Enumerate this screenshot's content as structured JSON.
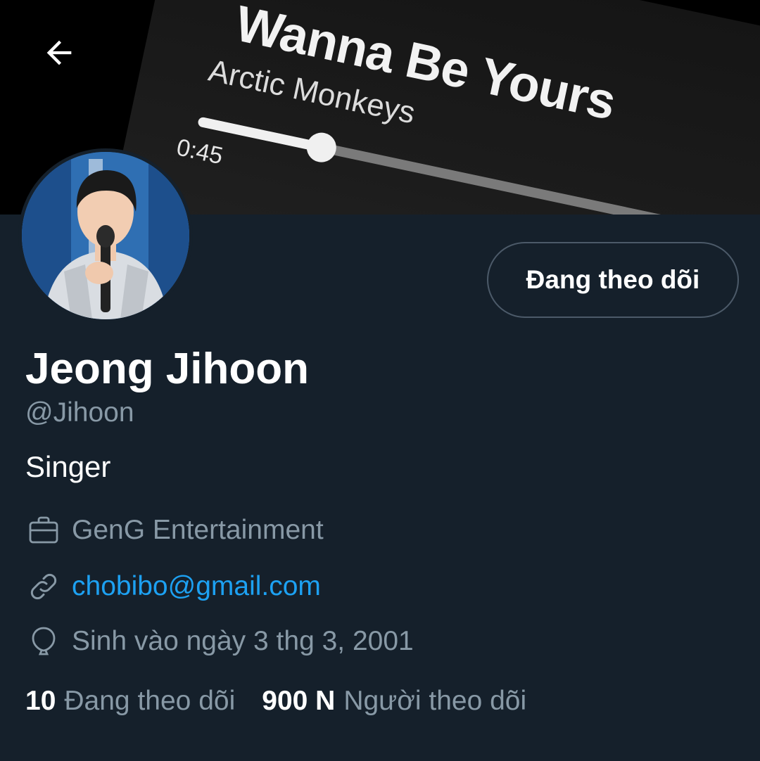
{
  "banner": {
    "song_title": "Wanna Be Yours",
    "artist": "Arctic Monkeys",
    "time": "0:45",
    "progress": 0.23
  },
  "profile": {
    "name": "Jeong Jihoon",
    "handle": "@Jihoon",
    "bio": "Singer",
    "follow_button_label": "Đang theo dõi",
    "company": "GenG Entertainment",
    "website": "chobibo@gmail.com",
    "birthday": "Sinh vào ngày 3 thg 3, 2001"
  },
  "stats": {
    "following_count": "10",
    "following_label": "Đang theo dõi",
    "followers_count": "900 N",
    "followers_label": "Người theo dõi"
  },
  "icons": {
    "back": "back-arrow-icon",
    "company": "briefcase-icon",
    "website": "link-icon",
    "birthday": "balloon-icon"
  },
  "colors": {
    "background": "#15202b",
    "secondary_text": "#8899a6",
    "link": "#1da1f2",
    "border": "#4c5a69"
  }
}
